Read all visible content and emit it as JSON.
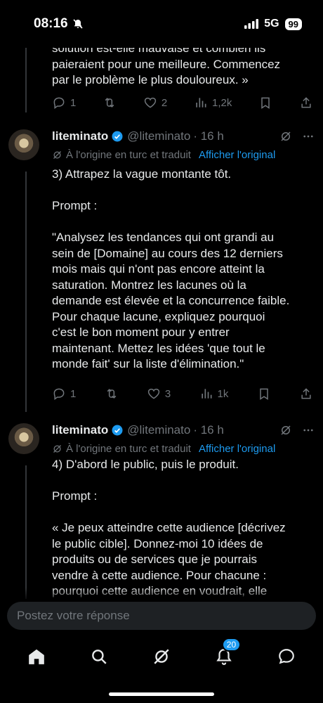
{
  "status_bar": {
    "time": "08:16",
    "network": "5G",
    "battery": "99"
  },
  "top_tweet": {
    "text": "solution est-elle mauvaise et combien ils\npaieraient pour une meilleure. Commencez\npar le problème le plus douloureux. »",
    "actions": {
      "replies": "1",
      "retweets": "",
      "likes": "2",
      "views": "1,2k"
    }
  },
  "tweets": [
    {
      "name": "liteminato",
      "handle": "@liteminato",
      "time": "· 16 h",
      "translation_note": "À l'origine en turc et traduit",
      "show_original": "Afficher l'original",
      "text": "3) Attrapez la vague montante tôt.\n\nPrompt :\n\n\"Analysez les tendances qui ont grandi au\nsein de [Domaine] au cours des 12 derniers\nmois mais qui n'ont pas encore atteint la\nsaturation. Montrez les lacunes où la\ndemande est élevée et la concurrence faible.\nPour chaque lacune, expliquez pourquoi\nc'est le bon moment pour y entrer\nmaintenant. Mettez les idées 'que tout le\nmonde fait' sur la liste d'élimination.\"",
      "actions": {
        "replies": "1",
        "retweets": "",
        "likes": "3",
        "views": "1k"
      }
    },
    {
      "name": "liteminato",
      "handle": "@liteminato",
      "time": "· 16 h",
      "translation_note": "À l'origine en turc et traduit",
      "show_original": "Afficher l'original",
      "text": "4) D'abord le public, puis le produit.\n\nPrompt :\n\n« Je peux atteindre cette audience [décrivez\nle public cible]. Donnez-moi 10 idées de\nproduits ou de services que je pourrais\nvendre à cette audience. Pour chacune :\npourquoi cette audience en voudrait, elle"
    }
  ],
  "reply_bar": {
    "placeholder": "Postez votre réponse"
  },
  "nav": {
    "notifications_badge": "20"
  },
  "colors": {
    "accent": "#1d9bf0",
    "muted": "#71767b",
    "text": "#e7e9ea",
    "background": "#000000"
  }
}
